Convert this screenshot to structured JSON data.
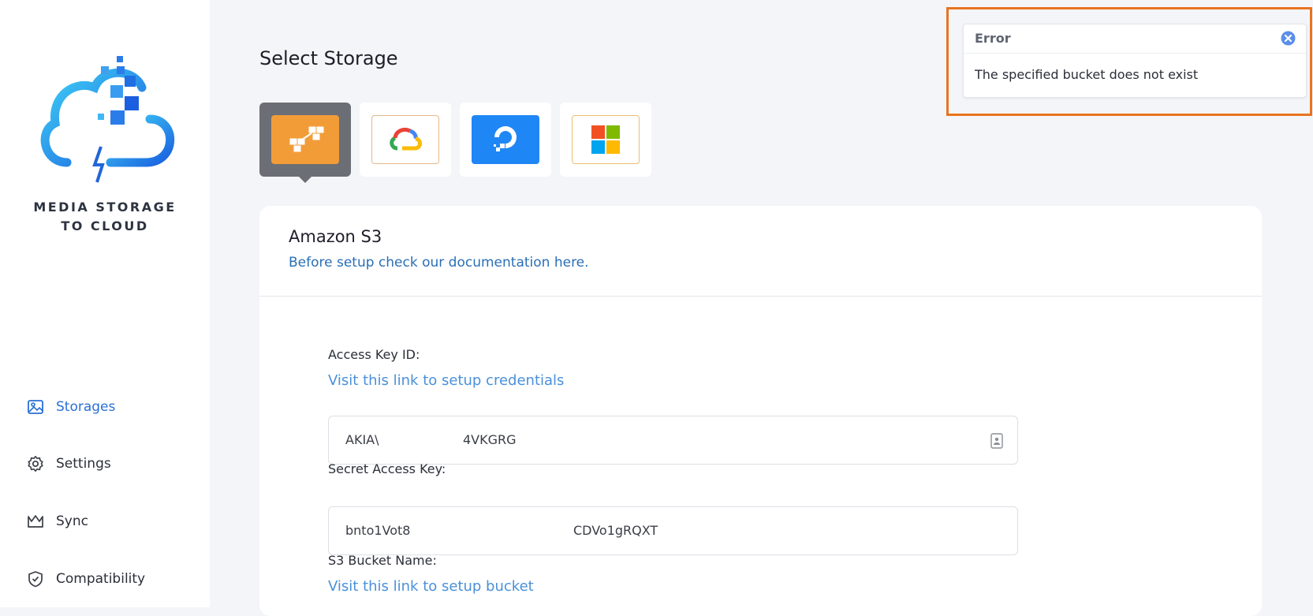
{
  "sidebar": {
    "brand_line1": "MEDIA STORAGE",
    "brand_line2": "TO CLOUD",
    "items": [
      {
        "label": "Storages",
        "icon": "image-icon",
        "active": true
      },
      {
        "label": "Settings",
        "icon": "gear-icon",
        "active": false
      },
      {
        "label": "Sync",
        "icon": "crown-icon",
        "active": false
      },
      {
        "label": "Compatibility",
        "icon": "shield-check-icon",
        "active": false
      }
    ]
  },
  "main": {
    "title": "Select Storage",
    "providers": [
      {
        "icon": "amazon-s3-icon",
        "selected": true
      },
      {
        "icon": "google-cloud-icon",
        "selected": false
      },
      {
        "icon": "digitalocean-icon",
        "selected": false
      },
      {
        "icon": "microsoft-azure-icon",
        "selected": false
      }
    ],
    "card": {
      "title": "Amazon S3",
      "doc_link": "Before setup check our documentation here.",
      "access_key_label": "Access Key ID:",
      "credentials_link": "Visit this link to setup credentials",
      "access_key_start": "AKIA\\",
      "access_key_end": "4VKGRG",
      "secret_key_label": "Secret Access Key:",
      "secret_key_start": "bnto1Vot8",
      "secret_key_end": "CDVo1gRQXT",
      "bucket_label": "S3 Bucket Name:",
      "bucket_link": "Visit this link to setup bucket"
    }
  },
  "toast": {
    "title": "Error",
    "message": "The specified bucket does not exist"
  },
  "colors": {
    "accent": "#2a6fd6",
    "highlight": "#e8731f",
    "aws": "#f29c38",
    "digitalocean": "#1f87f5"
  }
}
